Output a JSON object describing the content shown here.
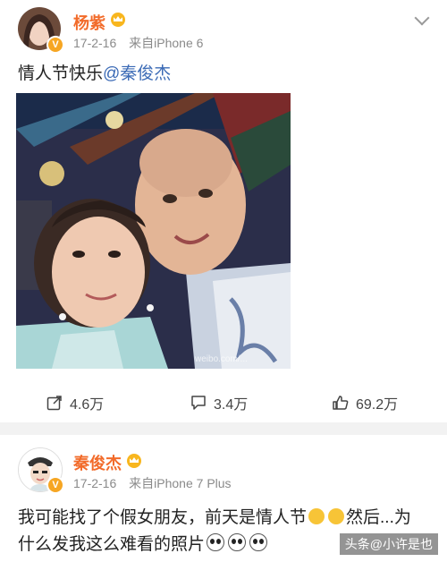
{
  "post1": {
    "author": "杨紫",
    "date": "17-2-16",
    "source": "来自iPhone 6",
    "text_prefix": "情人节快乐",
    "mention": "@秦俊杰",
    "photo_watermark": "weibo.com/...",
    "actions": {
      "repost_count": "4.6万",
      "comment_count": "3.4万",
      "like_count": "69.2万"
    }
  },
  "post2": {
    "author": "秦俊杰",
    "date": "17-2-16",
    "source": "来自iPhone 7 Plus",
    "text_line1": "我可能找了个假女朋友，前天是情人节",
    "text_line1_tail": "然后...为",
    "text_line2": "什么发我这么难看的照片"
  },
  "overlay_watermark": "头条@小许是也",
  "colors": {
    "name": "#f26b2a",
    "meta": "#8a8a8a",
    "mention": "#3c6bb6"
  }
}
